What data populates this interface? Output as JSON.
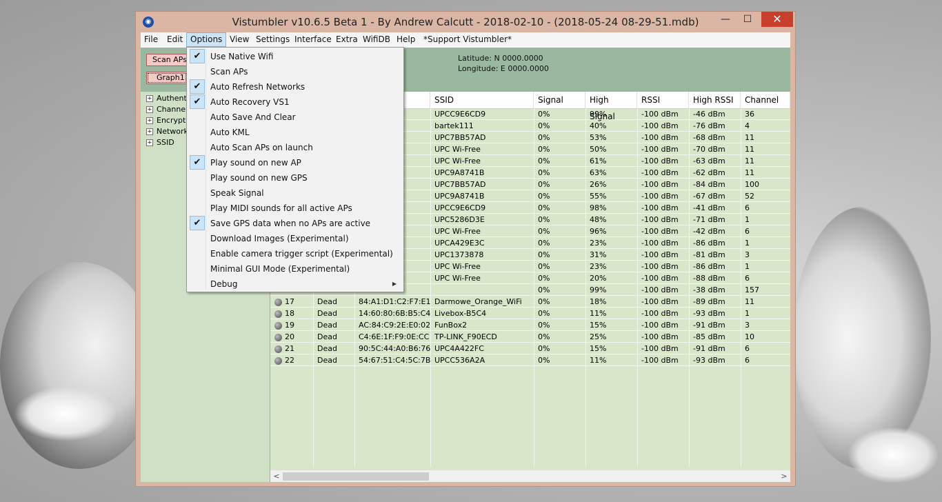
{
  "window": {
    "title": "Vistumbler v10.6.5 Beta 1 - By Andrew Calcutt - 2018-02-10 - (2018-05-24 08-29-51.mdb)",
    "minimize": "—",
    "maximize": "☐",
    "close": "✕"
  },
  "menu": [
    "File",
    "Edit",
    "Options",
    "View",
    "Settings",
    "Interface",
    "Extra",
    "WifiDB",
    "Help",
    "*Support Vistumbler*"
  ],
  "toolbar": {
    "scan_label": "Scan APs",
    "graph_label": "Graph1"
  },
  "gps": {
    "latitude": "Latitude: N 0000.0000",
    "longitude": "Longitude: E 0000.0000"
  },
  "tree": [
    "Authentication",
    "Channel",
    "Encryption",
    "Network Type",
    "SSID"
  ],
  "columns": [
    "",
    "",
    "",
    "SSID",
    "Signal",
    "High Signal",
    "RSSI",
    "High RSSI",
    "Channel"
  ],
  "rows": [
    {
      "num": "",
      "status": "",
      "mac": ":E:88",
      "ssid": "UPCC9E6CD9",
      "signal": "0%",
      "high_signal": "99%",
      "rssi": "-100 dBm",
      "high_rssi": "-46 dBm",
      "channel": "36"
    },
    {
      "num": "",
      "status": "",
      "mac": ":3:EE",
      "ssid": "bartek111",
      "signal": "0%",
      "high_signal": "40%",
      "rssi": "-100 dBm",
      "high_rssi": "-76 dBm",
      "channel": "4"
    },
    {
      "num": "",
      "status": "",
      "mac": "7:1A",
      "ssid": "UPC7BB57AD",
      "signal": "0%",
      "high_signal": "53%",
      "rssi": "-100 dBm",
      "high_rssi": "-68 dBm",
      "channel": "11"
    },
    {
      "num": "",
      "status": "",
      "mac": "7:1A",
      "ssid": "UPC Wi-Free",
      "signal": "0%",
      "high_signal": "50%",
      "rssi": "-100 dBm",
      "high_rssi": "-70 dBm",
      "channel": "11"
    },
    {
      "num": "",
      "status": "",
      "mac": "7:79",
      "ssid": "UPC Wi-Free",
      "signal": "0%",
      "high_signal": "61%",
      "rssi": "-100 dBm",
      "high_rssi": "-63 dBm",
      "channel": "11"
    },
    {
      "num": "",
      "status": "",
      "mac": "7:79",
      "ssid": "UPC9A8741B",
      "signal": "0%",
      "high_signal": "63%",
      "rssi": "-100 dBm",
      "high_rssi": "-62 dBm",
      "channel": "11"
    },
    {
      "num": "",
      "status": "",
      "mac": "7:57",
      "ssid": "UPC7BB57AD",
      "signal": "0%",
      "high_signal": "26%",
      "rssi": "-100 dBm",
      "high_rssi": "-84 dBm",
      "channel": "100"
    },
    {
      "num": "",
      "status": "",
      "mac": "7:67",
      "ssid": "UPC9A8741B",
      "signal": "0%",
      "high_signal": "55%",
      "rssi": "-100 dBm",
      "high_rssi": "-67 dBm",
      "channel": "52"
    },
    {
      "num": "",
      "status": "",
      "mac": "E:8B",
      "ssid": "UPCC9E6CD9",
      "signal": "0%",
      "high_signal": "98%",
      "rssi": "-100 dBm",
      "high_rssi": "-41 dBm",
      "channel": "6"
    },
    {
      "num": "",
      "status": "",
      "mac": "2:B2",
      "ssid": "UPC5286D3E",
      "signal": "0%",
      "high_signal": "48%",
      "rssi": "-100 dBm",
      "high_rssi": "-71 dBm",
      "channel": "1"
    },
    {
      "num": "",
      "status": "",
      "mac": "E:8B",
      "ssid": "UPC Wi-Free",
      "signal": "0%",
      "high_signal": "96%",
      "rssi": "-100 dBm",
      "high_rssi": "-42 dBm",
      "channel": "6"
    },
    {
      "num": "",
      "status": "",
      "mac": "6:DF",
      "ssid": "UPCA429E3C",
      "signal": "0%",
      "high_signal": "23%",
      "rssi": "-100 dBm",
      "high_rssi": "-86 dBm",
      "channel": "1"
    },
    {
      "num": "",
      "status": "",
      "mac": "0:F5",
      "ssid": "UPC1373878",
      "signal": "0%",
      "high_signal": "31%",
      "rssi": "-100 dBm",
      "high_rssi": "-81 dBm",
      "channel": "3"
    },
    {
      "num": "",
      "status": "",
      "mac": "6:DF",
      "ssid": "UPC Wi-Free",
      "signal": "0%",
      "high_signal": "23%",
      "rssi": "-100 dBm",
      "high_rssi": "-86 dBm",
      "channel": "1"
    },
    {
      "num": "",
      "status": "",
      "mac": "C:7B",
      "ssid": "UPC Wi-Free",
      "signal": "0%",
      "high_signal": "20%",
      "rssi": "-100 dBm",
      "high_rssi": "-88 dBm",
      "channel": "6"
    },
    {
      "num": "",
      "status": "",
      "mac": "9:B1",
      "ssid": "",
      "signal": "0%",
      "high_signal": "99%",
      "rssi": "-100 dBm",
      "high_rssi": "-38 dBm",
      "channel": "157"
    },
    {
      "num": "17",
      "status": "Dead",
      "mac": "84:A1:D1:C2:F7:E1",
      "ssid": "Darmowe_Orange_WiFi",
      "signal": "0%",
      "high_signal": "18%",
      "rssi": "-100 dBm",
      "high_rssi": "-89 dBm",
      "channel": "11"
    },
    {
      "num": "18",
      "status": "Dead",
      "mac": "14:60:80:6B:B5:C4",
      "ssid": "Livebox-B5C4",
      "signal": "0%",
      "high_signal": "11%",
      "rssi": "-100 dBm",
      "high_rssi": "-93 dBm",
      "channel": "1"
    },
    {
      "num": "19",
      "status": "Dead",
      "mac": "AC:84:C9:2E:E0:02",
      "ssid": "FunBox2",
      "signal": "0%",
      "high_signal": "15%",
      "rssi": "-100 dBm",
      "high_rssi": "-91 dBm",
      "channel": "3"
    },
    {
      "num": "20",
      "status": "Dead",
      "mac": "C4:6E:1F:F9:0E:CC",
      "ssid": "TP-LINK_F90ECD",
      "signal": "0%",
      "high_signal": "25%",
      "rssi": "-100 dBm",
      "high_rssi": "-85 dBm",
      "channel": "10"
    },
    {
      "num": "21",
      "status": "Dead",
      "mac": "90:5C:44:A0:B6:76",
      "ssid": "UPC4A422FC",
      "signal": "0%",
      "high_signal": "15%",
      "rssi": "-100 dBm",
      "high_rssi": "-91 dBm",
      "channel": "6"
    },
    {
      "num": "22",
      "status": "Dead",
      "mac": "54:67:51:C4:5C:7B",
      "ssid": "UPCC536A2A",
      "signal": "0%",
      "high_signal": "11%",
      "rssi": "-100 dBm",
      "high_rssi": "-93 dBm",
      "channel": "6"
    }
  ],
  "options_menu": [
    {
      "label": "Use Native Wifi",
      "checked": true
    },
    {
      "label": "Scan APs",
      "checked": false
    },
    {
      "label": "Auto Refresh Networks",
      "checked": true
    },
    {
      "label": "Auto Recovery VS1",
      "checked": true
    },
    {
      "label": "Auto Save And Clear",
      "checked": false
    },
    {
      "label": "Auto KML",
      "checked": false
    },
    {
      "label": "Auto Scan APs on launch",
      "checked": false
    },
    {
      "label": "Play sound on new AP",
      "checked": true
    },
    {
      "label": "Play sound on new GPS",
      "checked": false
    },
    {
      "label": "Speak Signal",
      "checked": false
    },
    {
      "label": "Play MIDI sounds for all active APs",
      "checked": false
    },
    {
      "label": "Save GPS data when no APs are active",
      "checked": true
    },
    {
      "label": "Download Images (Experimental)",
      "checked": false
    },
    {
      "label": "Enable camera trigger script (Experimental)",
      "checked": false
    },
    {
      "label": "Minimal GUI Mode (Experimental)",
      "checked": false
    },
    {
      "label": "Debug",
      "checked": false,
      "submenu": true
    }
  ],
  "scroll": {
    "left": "<",
    "right": ">"
  },
  "colors": {
    "list_bg": "#d8e6c9",
    "toolbar_bg": "#99b89f",
    "tree_bg": "#cfe0c7",
    "window_frame": "#dcb6a5",
    "close_button": "#c7402d"
  }
}
